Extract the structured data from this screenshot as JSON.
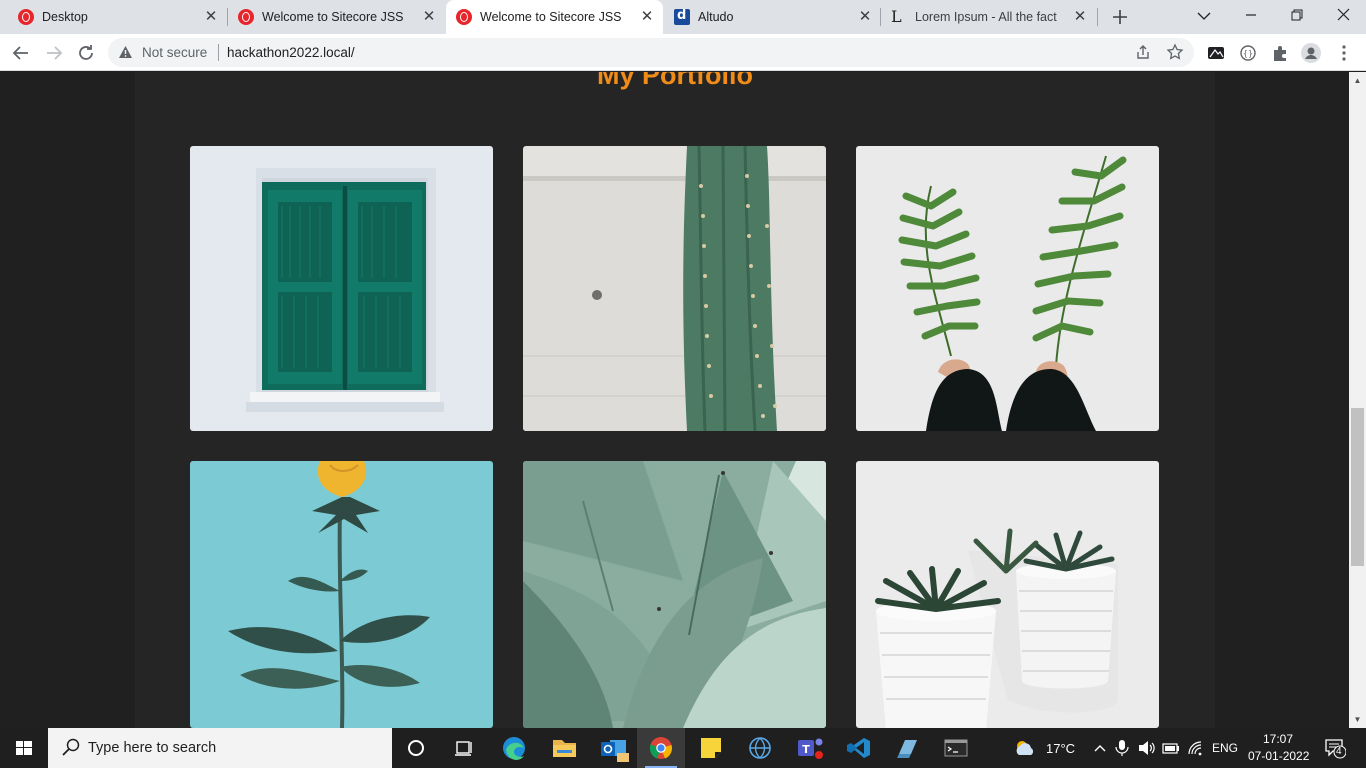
{
  "browser": {
    "tabs": [
      {
        "title": "Desktop",
        "icon": "opera-icon"
      },
      {
        "title": "Welcome to Sitecore JSS",
        "icon": "opera-icon"
      },
      {
        "title": "Welcome to Sitecore JSS",
        "icon": "opera-icon",
        "active": true
      },
      {
        "title": "Altudo",
        "icon": "altudo-icon"
      },
      {
        "title": "Lorem Ipsum - All the facts -",
        "icon": "lorem-icon"
      }
    ],
    "lorem_icon_glyph": "L",
    "new_tab_icon": "plus-icon",
    "security_label": "Not secure",
    "url": "hackathon2022.local/"
  },
  "page": {
    "heading": "My Portfolio",
    "heading_color": "#f28c18",
    "portfolio_items": [
      {
        "name": "green-window-photo"
      },
      {
        "name": "cactus-photo"
      },
      {
        "name": "fern-feet-photo"
      },
      {
        "name": "yellow-rose-photo"
      },
      {
        "name": "agave-photo"
      },
      {
        "name": "succulent-pots-photo"
      }
    ]
  },
  "taskbar": {
    "search_placeholder": "Type here to search",
    "weather": "17°C",
    "language": "ENG",
    "time": "17:07",
    "date": "07-01-2022",
    "notification_count": "4"
  }
}
